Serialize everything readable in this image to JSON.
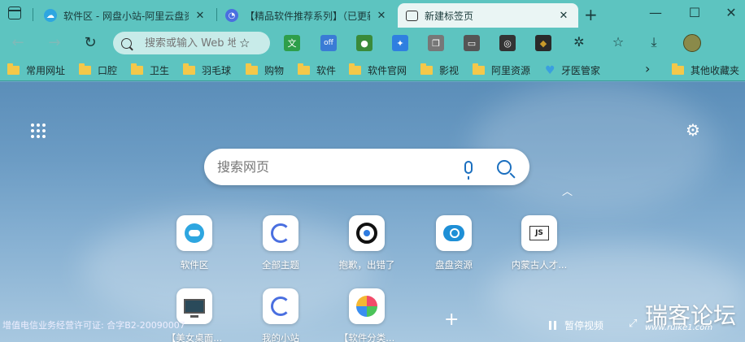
{
  "tabs": [
    {
      "title": "软件区 - 网盘小站-阿里云盘资源",
      "close": "✕",
      "favicon": "cloud-icon",
      "color": "#2ea6e0"
    },
    {
      "title": "【精品软件推荐系列】（已更新）",
      "close": "✕",
      "favicon": "swirl-icon",
      "color": "#4a6fe0"
    },
    {
      "title": "新建标签页",
      "close": "✕",
      "favicon": "newtab-icon",
      "color": "#333333"
    }
  ],
  "window": {
    "new_tab": "+",
    "minimize": "—",
    "maximize": "☐",
    "close": "✕"
  },
  "toolbar": {
    "address_placeholder": "搜索或输入 Web 地址",
    "back": "←",
    "forward": "→",
    "refresh": "↻",
    "add_favorite": "☆"
  },
  "extensions": [
    {
      "name": "translate-ext-icon",
      "glyph": "文",
      "color": "#2e9e4a"
    },
    {
      "name": "adblock-off-icon",
      "glyph": "off",
      "color": "#3a7bd5"
    },
    {
      "name": "globe-ext-icon",
      "glyph": "●",
      "color": "#3a8a3a"
    },
    {
      "name": "bird-ext-icon",
      "glyph": "✦",
      "color": "#2f7fe0"
    },
    {
      "name": "copy-ext-icon",
      "glyph": "❐",
      "color": "#666666"
    },
    {
      "name": "screen-ext-icon",
      "glyph": "▭",
      "color": "#555555"
    },
    {
      "name": "glasses-ext-icon",
      "glyph": "◎",
      "color": "#333333"
    },
    {
      "name": "diamond-ext-icon",
      "glyph": "◆",
      "color": "#c89a2a"
    }
  ],
  "tool_icons": {
    "extensions": "✲",
    "favorites": "☆",
    "downloads": "⤓"
  },
  "bookmarks": [
    {
      "label": "常用网址"
    },
    {
      "label": "口腔"
    },
    {
      "label": "卫生"
    },
    {
      "label": "羽毛球"
    },
    {
      "label": "购物"
    },
    {
      "label": "软件"
    },
    {
      "label": "软件官网"
    },
    {
      "label": "影视"
    },
    {
      "label": "阿里资源"
    },
    {
      "label": "牙医管家"
    }
  ],
  "bookmarks_more": "›",
  "other_favorites": "其他收藏夹",
  "newtab": {
    "search_placeholder": "搜索网页",
    "collapse": "︿",
    "settings": "⚙",
    "tiles": [
      {
        "label": "软件区"
      },
      {
        "label": "全部主题"
      },
      {
        "label": "抱歉，出错了"
      },
      {
        "label": "盘盘资源"
      },
      {
        "label": "内蒙古人才..."
      },
      {
        "label": "【美女桌面..."
      },
      {
        "label": "我的小站"
      },
      {
        "label": "【软件分类..."
      }
    ],
    "js_glyph": "JS",
    "add_tile": "+",
    "license": "增值电信业务经营许可证: 合字B2-20090007",
    "pause_video": "暂停视频",
    "expand": "⤢",
    "watermark": "瑞客论坛",
    "watermark_sub": "www.ruike1.com"
  }
}
